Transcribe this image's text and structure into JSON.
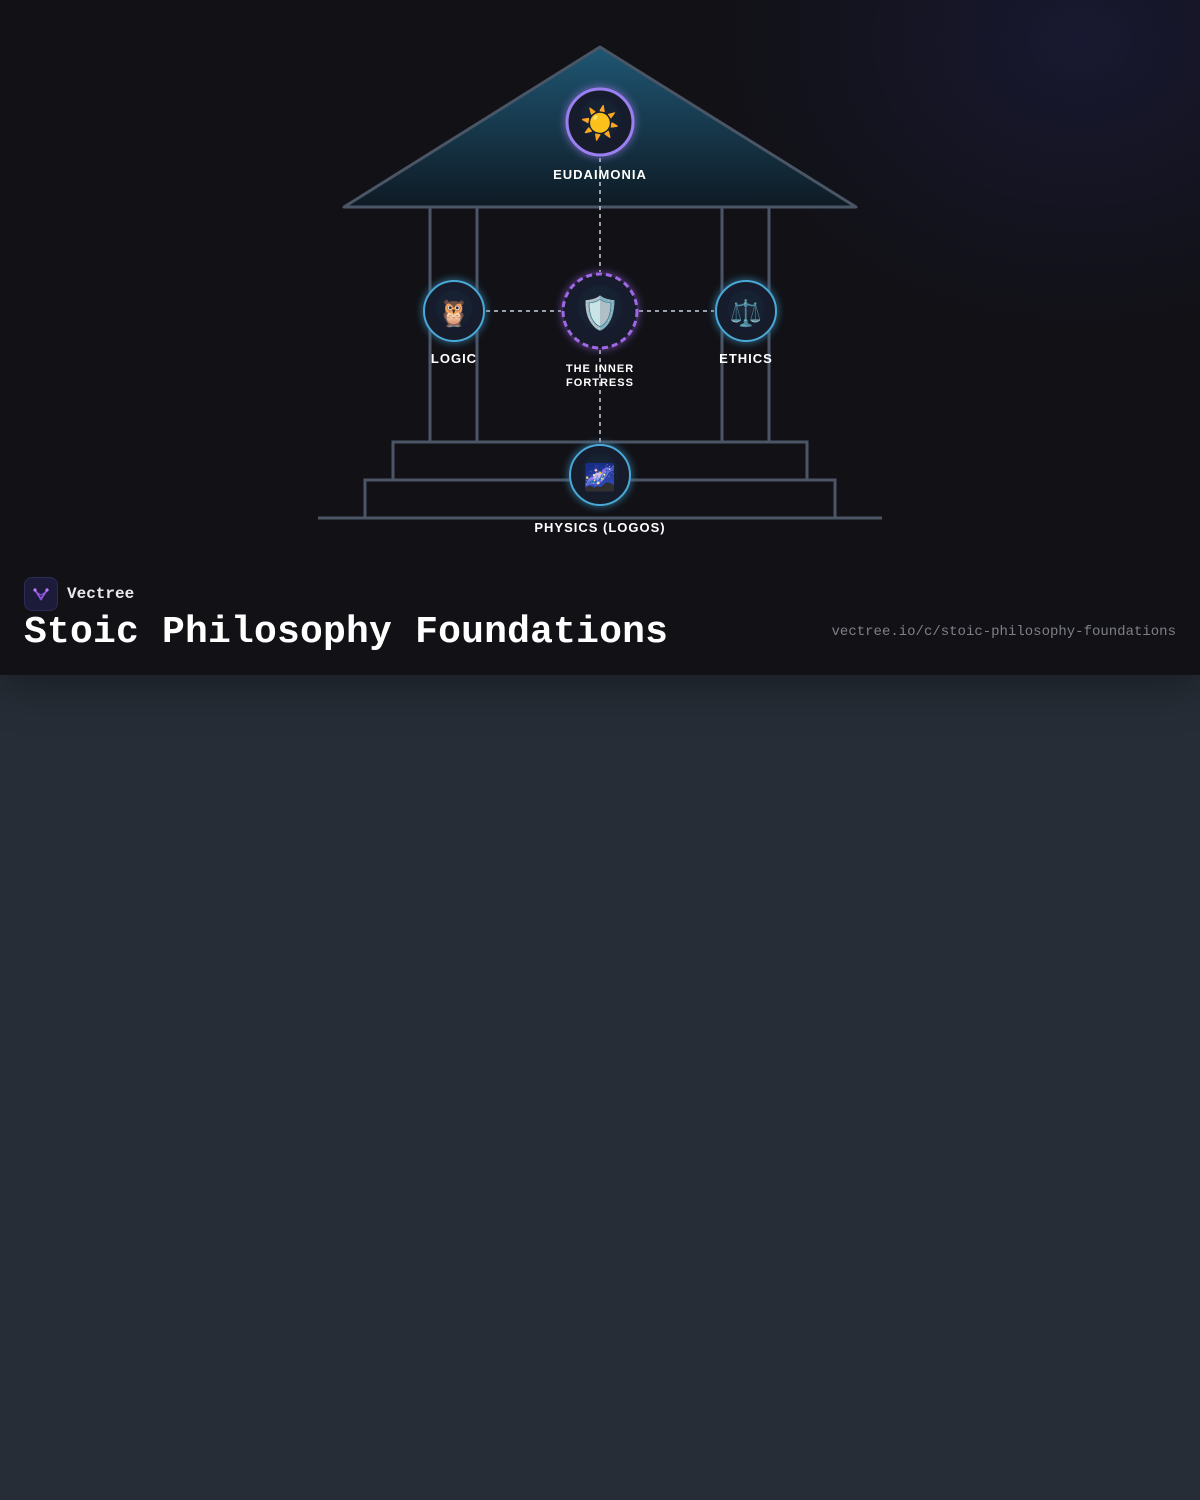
{
  "diagram": {
    "nodes": {
      "eudaimonia": {
        "label": "EUDAIMONIA",
        "icon": "sun-icon",
        "glyph": "☀️"
      },
      "logic": {
        "label": "LOGIC",
        "icon": "owl-icon",
        "glyph": "🦉"
      },
      "inner_fortress": {
        "label_line1": "THE INNER",
        "label_line2": "FORTRESS",
        "icon": "shield-icon",
        "glyph": "🛡️"
      },
      "ethics": {
        "label": "ETHICS",
        "icon": "scales-icon",
        "glyph": "⚖️"
      },
      "physics": {
        "label": "PHYSICS (LOGOS)",
        "icon": "galaxy-icon",
        "glyph": "🌌"
      }
    },
    "colors": {
      "node_border": "#4aa8d8",
      "center_border": "#a067e6",
      "top_border": "#9a7ff0",
      "structure_stroke": "#4a5566",
      "connector": "#9aa1ad"
    }
  },
  "footer": {
    "brand": "Vectree",
    "title": "Stoic Philosophy Foundations",
    "url": "vectree.io/c/stoic-philosophy-foundations"
  }
}
